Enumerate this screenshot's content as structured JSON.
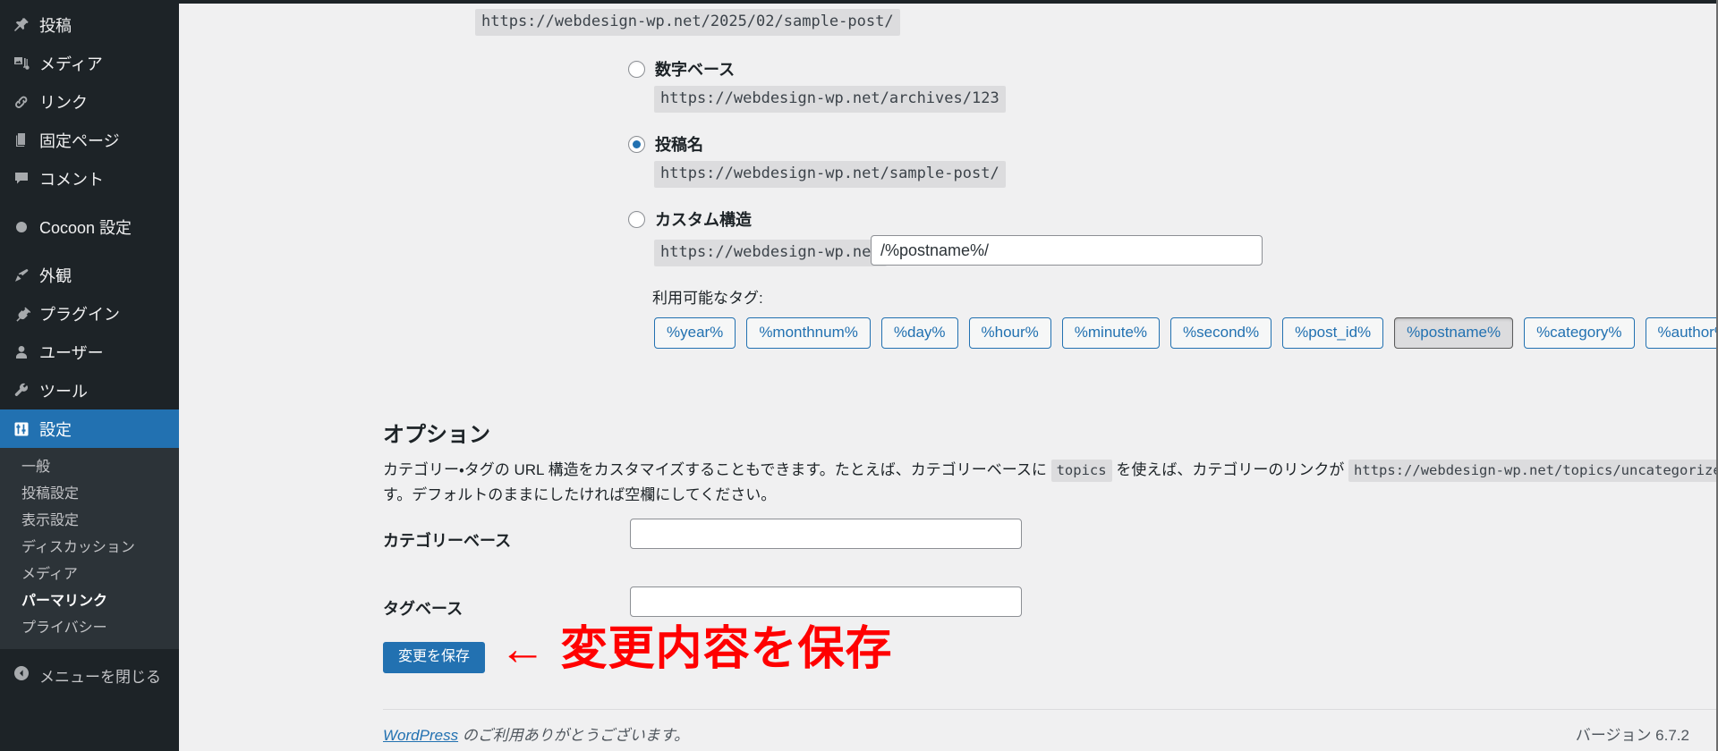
{
  "sidebar": {
    "items": [
      {
        "label": "投稿",
        "icon": "pin-icon"
      },
      {
        "label": "メディア",
        "icon": "media-icon"
      },
      {
        "label": "リンク",
        "icon": "link-icon"
      },
      {
        "label": "固定ページ",
        "icon": "pages-icon"
      },
      {
        "label": "コメント",
        "icon": "comment-icon"
      }
    ],
    "group2": [
      {
        "label": "Cocoon 設定",
        "icon": "circle-icon"
      }
    ],
    "group3": [
      {
        "label": "外観",
        "icon": "brush-icon"
      },
      {
        "label": "プラグイン",
        "icon": "plug-icon"
      },
      {
        "label": "ユーザー",
        "icon": "user-icon"
      },
      {
        "label": "ツール",
        "icon": "wrench-icon"
      }
    ],
    "current": {
      "label": "設定",
      "icon": "settings-icon"
    },
    "submenu": [
      {
        "label": "一般",
        "active": false
      },
      {
        "label": "投稿設定",
        "active": false
      },
      {
        "label": "表示設定",
        "active": false
      },
      {
        "label": "ディスカッション",
        "active": false
      },
      {
        "label": "メディア",
        "active": false
      },
      {
        "label": "パーマリンク",
        "active": true
      },
      {
        "label": "プライバシー",
        "active": false
      }
    ],
    "collapse": {
      "label": "メニューを閉じる",
      "icon": "collapse-arrow-icon"
    },
    "accent_color": "#2271b1",
    "background_color": "#1d2327",
    "submenu_background_color": "#2c3338"
  },
  "permalinks": {
    "day_and_name_example": "https://webdesign-wp.net/2025/02/sample-post/",
    "options": [
      {
        "label": "数字ベース",
        "example": "https://webdesign-wp.net/archives/123",
        "checked": false
      },
      {
        "label": "投稿名",
        "example": "https://webdesign-wp.net/sample-post/",
        "checked": true
      },
      {
        "label": "カスタム構造",
        "example": "https://webdesign-wp.net",
        "checked": false
      }
    ],
    "custom_structure_value": "/%postname%/",
    "available_tags_label": "利用可能なタグ:",
    "tags": [
      {
        "label": "%year%",
        "pressed": false
      },
      {
        "label": "%monthnum%",
        "pressed": false
      },
      {
        "label": "%day%",
        "pressed": false
      },
      {
        "label": "%hour%",
        "pressed": false
      },
      {
        "label": "%minute%",
        "pressed": false
      },
      {
        "label": "%second%",
        "pressed": false
      },
      {
        "label": "%post_id%",
        "pressed": false
      },
      {
        "label": "%postname%",
        "pressed": true
      },
      {
        "label": "%category%",
        "pressed": false
      },
      {
        "label": "%author%",
        "pressed": false
      }
    ]
  },
  "options_section": {
    "title": "オプション",
    "desc_part1": "カテゴリー・タグの URL 構造をカスタマイズすることもできます。たとえば、カテゴリーベースに ",
    "desc_code1": "topics",
    "desc_part2": " を使えば、カテゴリーのリンクが ",
    "desc_code2": "https://webdesign-wp.net/topics/uncategorized/",
    "desc_part3": " のようになります。デフォルトのままにしたければ空欄にしてください。",
    "category_base": {
      "label": "カテゴリーベース",
      "value": "",
      "placeholder": ""
    },
    "tag_base": {
      "label": "タグベース",
      "value": "",
      "placeholder": ""
    }
  },
  "save": {
    "button_label": "変更を保存",
    "annotation": "←  変更内容を保存",
    "annotation_color": "#ff0000"
  },
  "footer": {
    "link_label": "WordPress",
    "thanks_text": " のご利用ありがとうございます。",
    "version": "バージョン 6.7.2"
  }
}
